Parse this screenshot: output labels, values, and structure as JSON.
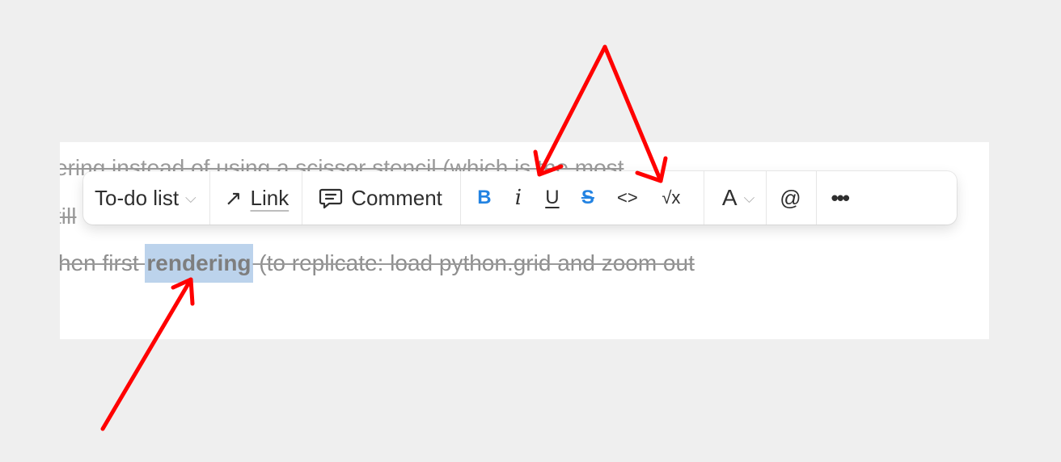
{
  "document": {
    "line1": "ering instead of using a scissor stencil (which is the most",
    "line2": "till",
    "line3_before": "hen first ",
    "line3_selected": "rendering",
    "line3_after": " (to replicate: load python.grid and zoom out"
  },
  "toolbar": {
    "block_type": {
      "label": "To-do list",
      "icon": "chevron-down-icon"
    },
    "link": {
      "label": "Link",
      "icon": "arrow-up-right-icon"
    },
    "comment": {
      "label": "Comment",
      "icon": "comment-icon"
    },
    "bold": {
      "glyph": "B",
      "active": true
    },
    "italic": {
      "glyph": "i",
      "active": false
    },
    "underline": {
      "glyph": "U",
      "active": false
    },
    "strikethrough": {
      "glyph": "S",
      "active": true
    },
    "code": {
      "glyph": "<>"
    },
    "equation": {
      "glyph": "√x"
    },
    "text_color": {
      "glyph": "A",
      "icon": "chevron-down-icon"
    },
    "mention": {
      "glyph": "@"
    },
    "more": {
      "glyph": "•••"
    }
  },
  "colors": {
    "active": "#2383e2",
    "selection": "#bcd3ec",
    "annotation_arrows": "#ff0000"
  }
}
